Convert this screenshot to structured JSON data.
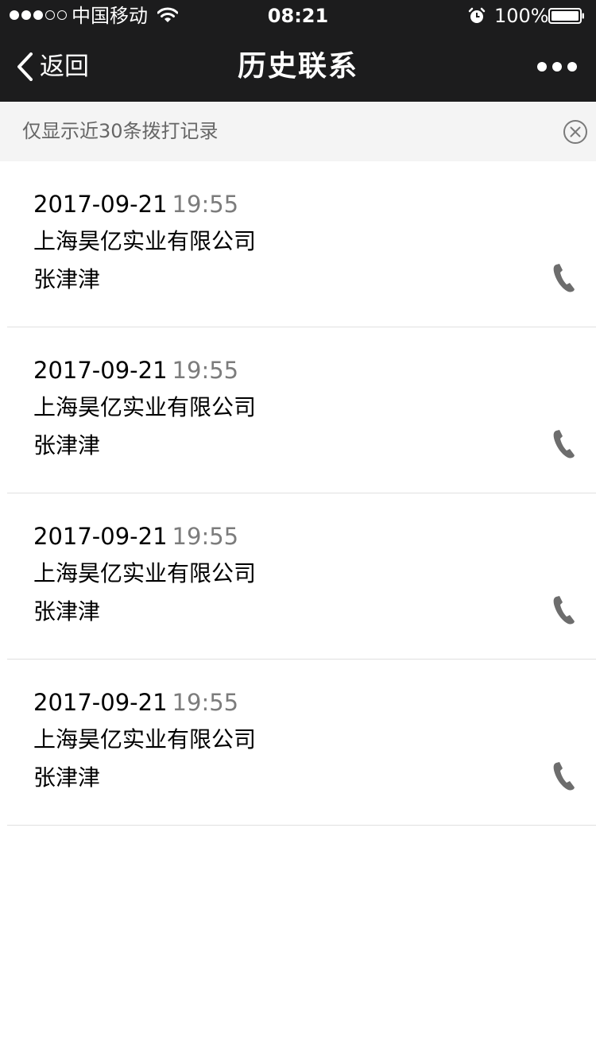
{
  "status_bar": {
    "carrier": "中国移动",
    "time": "08:21",
    "battery_percent": "100%",
    "signal_bars_filled": 3,
    "signal_bars_total": 5
  },
  "nav": {
    "back_label": "返回",
    "title": "历史联系"
  },
  "notice": {
    "text": "仅显示近30条拨打记录"
  },
  "records": [
    {
      "date": "2017-09-21",
      "time": "19:55",
      "company": "上海昊亿实业有限公司",
      "contact": "张津津"
    },
    {
      "date": "2017-09-21",
      "time": "19:55",
      "company": "上海昊亿实业有限公司",
      "contact": "张津津"
    },
    {
      "date": "2017-09-21",
      "time": "19:55",
      "company": "上海昊亿实业有限公司",
      "contact": "张津津"
    },
    {
      "date": "2017-09-21",
      "time": "19:55",
      "company": "上海昊亿实业有限公司",
      "contact": "张津津"
    }
  ],
  "colors": {
    "header_bg": "#1c1c1d",
    "notice_bg": "#f4f4f4",
    "notice_text": "#666666",
    "time_text": "#7c7c7c",
    "divider": "#e0e0e0",
    "phone_icon": "#6d6d6d"
  },
  "icons": {
    "signal": "signal-dots-icon",
    "wifi": "wifi-icon",
    "alarm": "alarm-clock-icon",
    "battery": "battery-icon",
    "back": "chevron-left-icon",
    "more": "more-dots-icon",
    "close": "close-circle-icon",
    "call": "phone-icon"
  }
}
